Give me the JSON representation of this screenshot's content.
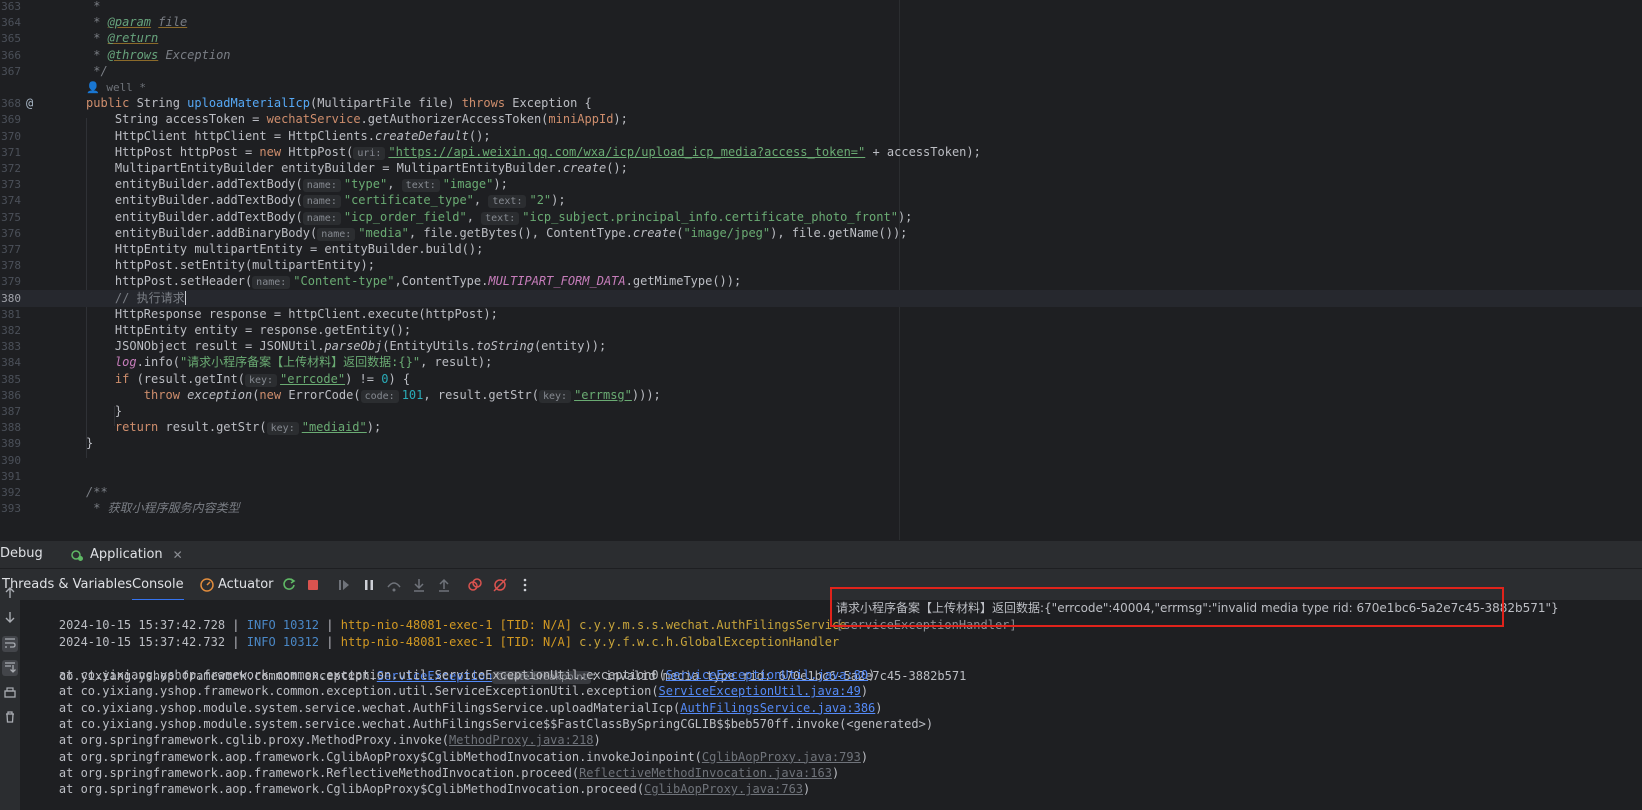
{
  "editor": {
    "lines": [
      {
        "n": "363",
        "html": "<span class=\"cm\"> *</span>"
      },
      {
        "n": "364",
        "html": "<span class=\"cm\"> * </span><span class=\"tag\">@param</span><span class=\"cm\"> </span><span class=\"cm\" style=\"text-decoration:underline;text-decoration-color:#8b6a2a\">file</span>"
      },
      {
        "n": "365",
        "html": "<span class=\"cm\"> * </span><span class=\"tag\">@return</span>"
      },
      {
        "n": "366",
        "html": "<span class=\"cm\"> * </span><span class=\"tag\">@throws</span><span class=\"cm\"> Exception</span>"
      },
      {
        "n": "367",
        "html": "<span class=\"cm\"> */</span>"
      },
      {
        "n": "",
        "html": "<span class=\"author\">&#128100; well *</span>"
      },
      {
        "n": "368",
        "mark": "@",
        "html": "<span class=\"kw\">public</span> String <span class=\"fn\">uploadMaterialIcp</span>(MultipartFile file) <span class=\"kw\">throws</span> Exception {"
      },
      {
        "n": "369",
        "html": "    String accessToken = <span class=\"kw\">wechatService</span>.getAuthorizerAccessToken(<span class=\"kw\">miniAppId</span>);"
      },
      {
        "n": "370",
        "html": "    HttpClient httpClient = HttpClients.<span class=\"it\">createDefault</span>();"
      },
      {
        "n": "371",
        "html": "    HttpPost httpPost = <span class=\"kw\">new</span> HttpPost(<span class=\"hint\">uri:</span><span class=\"strl\">\"https://api.weixin.qq.com/wxa/icp/upload_icp_media?access_token=\"</span> + accessToken);"
      },
      {
        "n": "372",
        "html": "    MultipartEntityBuilder entityBuilder = MultipartEntityBuilder.<span class=\"it\">create</span>();"
      },
      {
        "n": "373",
        "html": "    entityBuilder.addTextBody(<span class=\"hint\">name:</span><span class=\"str\">\"type\"</span>, <span class=\"hint\">text:</span><span class=\"str\">\"image\"</span>);"
      },
      {
        "n": "374",
        "html": "    entityBuilder.addTextBody(<span class=\"hint\">name:</span><span class=\"str\">\"certificate_type\"</span>, <span class=\"hint\">text:</span><span class=\"str\">\"2\"</span>);"
      },
      {
        "n": "375",
        "html": "    entityBuilder.addTextBody(<span class=\"hint\">name:</span><span class=\"str\">\"icp_order_field\"</span>, <span class=\"hint\">text:</span><span class=\"str\">\"icp_subject.principal_info.certificate_photo_front\"</span>);"
      },
      {
        "n": "376",
        "html": "    entityBuilder.addBinaryBody(<span class=\"hint\">name:</span><span class=\"str\">\"media\"</span>, file.getBytes(), ContentType.<span class=\"it\">create</span>(<span class=\"str\">\"image/jpeg\"</span>), file.getName());"
      },
      {
        "n": "377",
        "html": "    HttpEntity multipartEntity = entityBuilder.build();"
      },
      {
        "n": "378",
        "html": "    httpPost.setEntity(multipartEntity);"
      },
      {
        "n": "379",
        "html": "    httpPost.setHeader(<span class=\"hint\">name:</span><span class=\"str\">\"Content-type\"</span>,ContentType.<span class=\"fld\">MULTIPART_FORM_DATA</span>.getMimeType());"
      },
      {
        "n": "380",
        "current": true,
        "html": "    <span class=\"cmt\">// 执行请求</span><span class=\"caret\"></span>"
      },
      {
        "n": "381",
        "html": "    HttpResponse response = httpClient.execute(httpPost);"
      },
      {
        "n": "382",
        "html": "    HttpEntity entity = response.getEntity();"
      },
      {
        "n": "383",
        "html": "    JSONObject result = JSONUtil.<span class=\"it\">parseObj</span>(EntityUtils.<span class=\"it\">toString</span>(entity));"
      },
      {
        "n": "384",
        "html": "    <span class=\"fld\">log</span>.info(<span class=\"str\">\"请求小程序备案【上传材料】返回数据:{}\"</span>, result);"
      },
      {
        "n": "385",
        "html": "    <span class=\"kw\">if</span> (result.getInt(<span class=\"hint\">key:</span><span class=\"strl\">\"errcode\"</span>) != <span class=\"num\">0</span>) {"
      },
      {
        "n": "386",
        "html": "        <span class=\"kw\">throw</span> <span class=\"it\">exception</span>(<span class=\"kw\">new</span> ErrorCode(<span class=\"hint\">code:</span><span class=\"num\">101</span>, result.getStr(<span class=\"hint\">key:</span><span class=\"strl\">\"errmsg\"</span>)));"
      },
      {
        "n": "387",
        "html": "    }"
      },
      {
        "n": "388",
        "html": "    <span class=\"kw\">return</span> result.getStr(<span class=\"hint\">key:</span><span class=\"strl\">\"mediaid\"</span>);"
      },
      {
        "n": "389",
        "html": "}"
      },
      {
        "n": "390",
        "html": ""
      },
      {
        "n": "391",
        "html": ""
      },
      {
        "n": "392",
        "html": "<span class=\"cm\">/**</span>"
      },
      {
        "n": "393",
        "html": "<span class=\"cm\"> * 获取小程序服务内容类型</span>"
      }
    ]
  },
  "debug_tabs": {
    "debug_label": "Debug",
    "app_label": "Application",
    "close": "✕"
  },
  "toolbar": {
    "threads_label": "Threads & Variables",
    "console_label": "Console",
    "actuator_label": "Actuator"
  },
  "console": {
    "log1": {
      "ts": "2024-10-15 15:37:42.728",
      "level": "INFO",
      "pid": "10312",
      "thread": "http-nio-48081-exec-1",
      "tid": "[TID: N/A]",
      "logger": "c.y.y.m.s.s.wechat.AuthFilingsService",
      "msg": "请求小程序备案【上传材料】返回数据:{\"errcode\":40004,\"errmsg\":\"invalid media type rid: 670e1bc6-5a2e7c45-3882b571\"}"
    },
    "log2": {
      "ts": "2024-10-15 15:37:42.732",
      "level": "INFO",
      "pid": "10312",
      "thread": "http-nio-48081-exec-1",
      "tid": "[TID: N/A]",
      "logger": "c.y.y.f.w.c.h.GlobalExceptionHandler",
      "msg": "[serviceExceptionHandler]"
    },
    "exception": {
      "prefix": "co.yixiang.yshop.framework.common.exception.",
      "class_link": "ServiceException",
      "chip": "Create breakpoint",
      "message": ": invalid media type rid: 670e1bc6-5a2e7c45-3882b571"
    },
    "stack": [
      {
        "text": "    at co.yixiang.yshop.framework.common.exception.util.ServiceExceptionUtil.exception0(",
        "link": "ServiceExceptionUtil.java:80",
        "tail": ")",
        "gray": false
      },
      {
        "text": "    at co.yixiang.yshop.framework.common.exception.util.ServiceExceptionUtil.exception(",
        "link": "ServiceExceptionUtil.java:49",
        "tail": ")",
        "gray": false
      },
      {
        "text": "    at co.yixiang.yshop.module.system.service.wechat.AuthFilingsService.uploadMaterialIcp(",
        "link": "AuthFilingsService.java:386",
        "tail": ")",
        "gray": false
      },
      {
        "text": "    at co.yixiang.yshop.module.system.service.wechat.AuthFilingsService$$FastClassBySpringCGLIB$$beb570ff.invoke(<generated>)",
        "link": "",
        "tail": "",
        "gray": false
      },
      {
        "text": "    at org.springframework.cglib.proxy.MethodProxy.invoke(",
        "link": "MethodProxy.java:218",
        "tail": ")",
        "gray": true
      },
      {
        "text": "    at org.springframework.aop.framework.CglibAopProxy$CglibMethodInvocation.invokeJoinpoint(",
        "link": "CglibAopProxy.java:793",
        "tail": ")",
        "gray": true
      },
      {
        "text": "    at org.springframework.aop.framework.ReflectiveMethodInvocation.proceed(",
        "link": "ReflectiveMethodInvocation.java:163",
        "tail": ")",
        "gray": true
      },
      {
        "text": "    at org.springframework.aop.framework.CglibAopProxy$CglibMethodInvocation.proceed(",
        "link": "CglibAopProxy.java:763",
        "tail": ")",
        "gray": true
      }
    ]
  },
  "colors": {
    "highlight_box": "#e0231b",
    "accent": "#3574f0"
  }
}
